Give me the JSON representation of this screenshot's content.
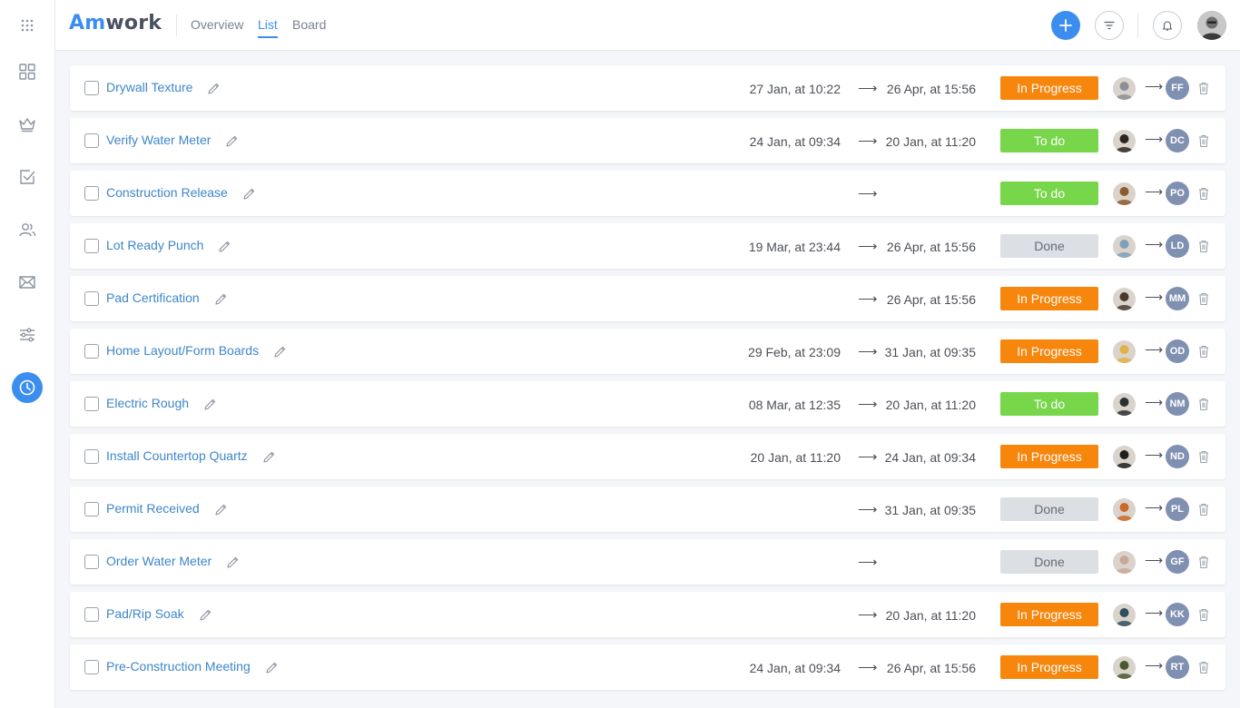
{
  "app": {
    "logo_first": "Am",
    "logo_second": "work"
  },
  "header": {
    "tabs": [
      "Overview",
      "List",
      "Board"
    ],
    "active_tab": "List"
  },
  "colors": {
    "accent": "#3b8ef0",
    "in_progress": "#f7860d",
    "todo": "#78d64b",
    "done": "#dcdfe4",
    "assignee": "#7f90b1",
    "title": "#3d86c9"
  },
  "sidebar": {
    "icons": [
      "apps-grid-icon",
      "dashboard-icon",
      "crown-icon",
      "checkbox-icon",
      "users-icon",
      "mail-icon",
      "sliders-icon",
      "clock-icon"
    ],
    "active": "clock-icon"
  },
  "tasks": [
    {
      "title": "Drywall Texture",
      "start": "27 Jan, at 10:22",
      "end": "26 Apr, at 15:56",
      "status": "In Progress",
      "from_color": "#8b8f94",
      "to": "FF"
    },
    {
      "title": "Verify Water Meter",
      "start": "24 Jan, at 09:34",
      "end": "20 Jan, at 11:20",
      "status": "To do",
      "from_color": "#2b2421",
      "to": "DC"
    },
    {
      "title": "Construction Release",
      "start": "",
      "end": "",
      "status": "To do",
      "from_color": "#8c5a2e",
      "to": "PO"
    },
    {
      "title": "Lot Ready Punch",
      "start": "19 Mar, at 23:44",
      "end": "26 Apr, at 15:56",
      "status": "Done",
      "from_color": "#7fa0b8",
      "to": "LD"
    },
    {
      "title": "Pad Certification",
      "start": "",
      "end": "26 Apr, at 15:56",
      "status": "In Progress",
      "from_color": "#4a3a2e",
      "to": "MM"
    },
    {
      "title": "Home Layout/Form Boards",
      "start": "29 Feb, at 23:09",
      "end": "31 Jan, at 09:35",
      "status": "In Progress",
      "from_color": "#e3b04a",
      "to": "OD"
    },
    {
      "title": "Electric Rough",
      "start": "08 Mar, at 12:35",
      "end": "20 Jan, at 11:20",
      "status": "To do",
      "from_color": "#2a2f33",
      "to": "NM"
    },
    {
      "title": "Install Countertop Quartz",
      "start": "20 Jan, at 11:20",
      "end": "24 Jan, at 09:34",
      "status": "In Progress",
      "from_color": "#1f1f1f",
      "to": "ND"
    },
    {
      "title": "Permit Received",
      "start": "",
      "end": "31 Jan, at 09:35",
      "status": "Done",
      "from_color": "#c96a28",
      "to": "PL"
    },
    {
      "title": "Order Water Meter",
      "start": "",
      "end": "",
      "status": "Done",
      "from_color": "#c9a89a",
      "to": "GF"
    },
    {
      "title": "Pad/Rip Soak",
      "start": "",
      "end": "20 Jan, at 11:20",
      "status": "In Progress",
      "from_color": "#2f4f5f",
      "to": "KK"
    },
    {
      "title": "Pre-Construction Meeting",
      "start": "24 Jan, at 09:34",
      "end": "26 Apr, at 15:56",
      "status": "In Progress",
      "from_color": "#4a5a2f",
      "to": "RT"
    }
  ]
}
